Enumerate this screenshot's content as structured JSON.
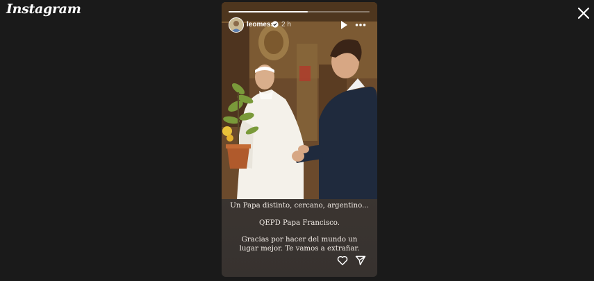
{
  "app": {
    "logo_text": "Instagram"
  },
  "story": {
    "progress": 0.56,
    "user": {
      "username": "leomessi",
      "verified": true,
      "time_ago": "2 h"
    },
    "caption": {
      "line1": "Un Papa distinto, cercano, argentino...",
      "line2": "QEPD Papa Francisco.",
      "line3": "Gracias por hacer del mundo un lugar mejor. Te vamos a extrañar."
    }
  },
  "icons": {
    "close": "close-icon",
    "play": "play-icon",
    "more": "more-icon",
    "like": "heart-icon",
    "share": "send-icon",
    "verified": "verified-badge-icon"
  }
}
